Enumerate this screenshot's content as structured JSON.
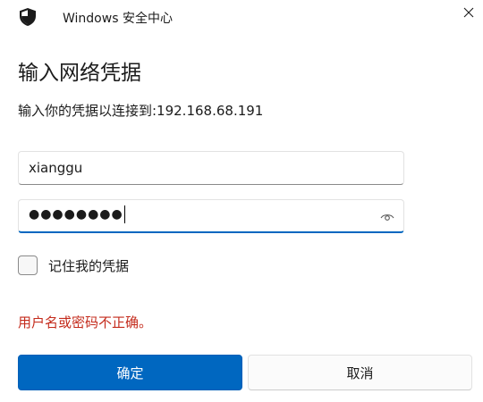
{
  "window": {
    "app_title": "Windows 安全中心",
    "heading": "输入网络凭据",
    "subtitle": "输入你的凭据以连接到:192.168.68.191"
  },
  "form": {
    "username_value": "xianggu",
    "password_masked": "●●●●●●●●",
    "remember_label": "记住我的凭据",
    "remember_checked": false
  },
  "error": {
    "message": "用户名或密码不正确。"
  },
  "buttons": {
    "ok_label": "确定",
    "cancel_label": "取消"
  },
  "icons": {
    "app_icon": "shield-icon",
    "close_icon": "close-icon",
    "reveal_icon": "eye-icon"
  },
  "colors": {
    "accent": "#0067c0",
    "error": "#c42b1c"
  }
}
